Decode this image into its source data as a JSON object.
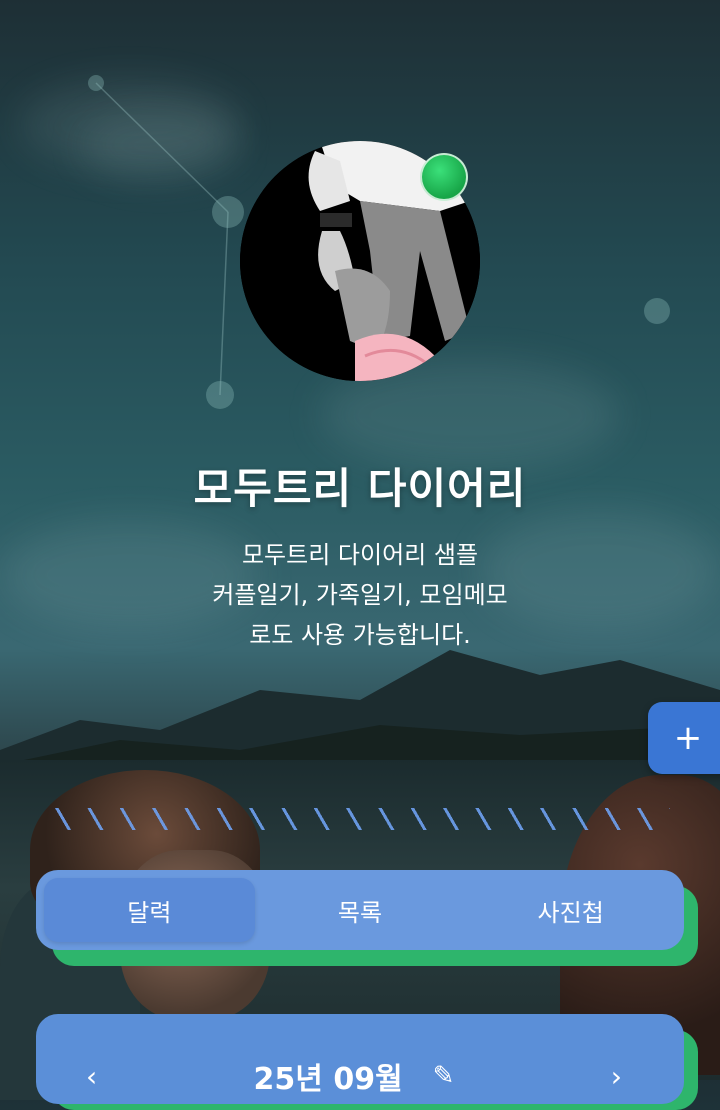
{
  "app": {
    "title": "모두트리 다이어리",
    "description": [
      "모두트리 다이어리 샘플",
      "커플일기, 가족일기, 모임메모",
      "로도 사용 가능합니다."
    ]
  },
  "profile": {
    "avatar_icon": "profile-avatar-illustration",
    "status": "online",
    "status_color": "#22c55e"
  },
  "fab": {
    "icon": "plus-icon",
    "label": "+"
  },
  "tabs": [
    {
      "label": "달력",
      "active": true
    },
    {
      "label": "목록",
      "active": false
    },
    {
      "label": "사진첩",
      "active": false
    }
  ],
  "calendar": {
    "month_label": "25년 09월",
    "prev_icon": "chevron-left-icon",
    "next_icon": "chevron-right-icon",
    "edit_icon": "pencil-icon"
  },
  "colors": {
    "accent_blue": "#6a99de",
    "accent_green": "#2eb56c",
    "fab_blue": "#3a76d4"
  }
}
